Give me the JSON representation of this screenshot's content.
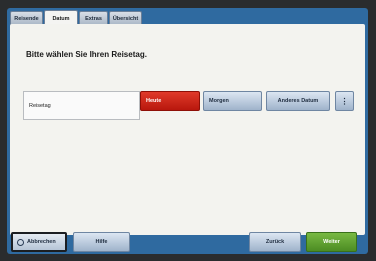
{
  "tabs": [
    {
      "label": "Reisende"
    },
    {
      "label": "Datum"
    },
    {
      "label": "Extras"
    },
    {
      "label": "Übersicht"
    }
  ],
  "main": {
    "title": "Bitte wählen Sie Ihren Reisetag.",
    "travel_day_label": "Reisetag",
    "buttons": {
      "today": "Heute",
      "tomorrow": "Morgen",
      "other_date": "Anderes Datum",
      "more": "⋮"
    }
  },
  "footer": {
    "cancel": "Abbrechen",
    "help": "Hilfe",
    "back": "Zurück",
    "next": "Weiter"
  },
  "colors": {
    "active_selection": "#d42a1a",
    "primary_action": "#5fa12f",
    "frame": "#2f6aa0"
  }
}
